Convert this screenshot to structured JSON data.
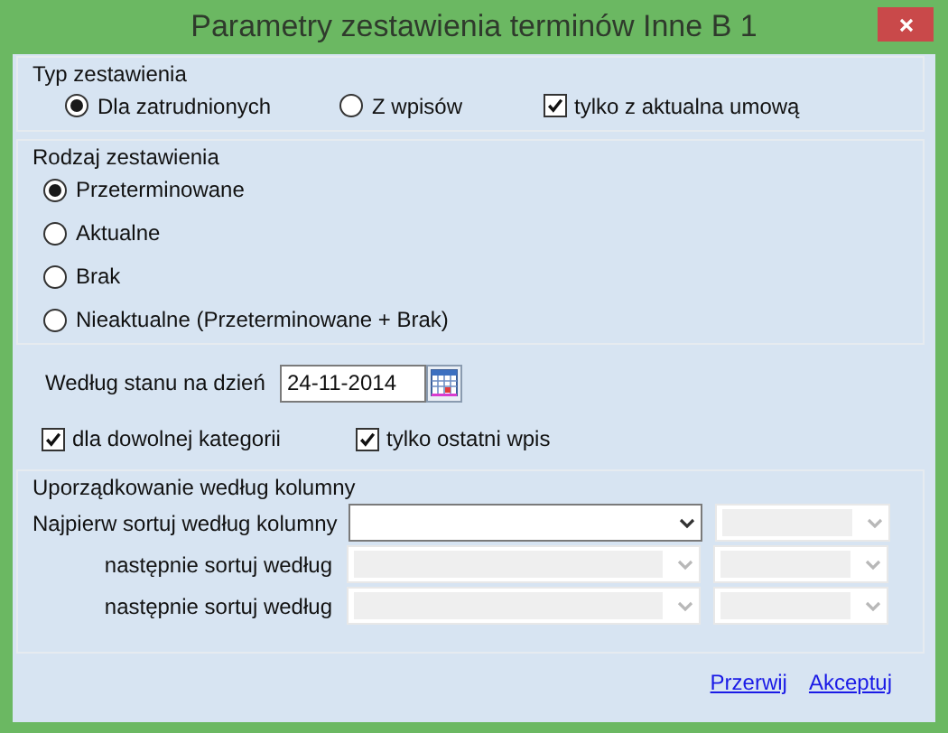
{
  "window": {
    "title": "Parametry zestawienia terminów Inne B 1"
  },
  "type_group": {
    "title": "Typ zestawienia",
    "options": [
      {
        "label": "Dla zatrudnionych",
        "selected": true
      },
      {
        "label": "Z wpisów",
        "selected": false
      }
    ],
    "current_contract": {
      "label": "tylko z aktualna umową",
      "checked": true
    }
  },
  "kind_group": {
    "title": "Rodzaj zestawienia",
    "options": [
      {
        "label": "Przeterminowane",
        "selected": true
      },
      {
        "label": "Aktualne",
        "selected": false
      },
      {
        "label": "Brak",
        "selected": false
      },
      {
        "label": "Nieaktualne (Przeterminowane + Brak)",
        "selected": false
      }
    ]
  },
  "date": {
    "label": "Według stanu na dzień",
    "value": "24-11-2014"
  },
  "checks": [
    {
      "label": "dla dowolnej kategorii",
      "checked": true
    },
    {
      "label": "tylko ostatni wpis",
      "checked": true
    }
  ],
  "sort_group": {
    "title": "Uporządkowanie według kolumny",
    "rows": [
      {
        "label": "Najpierw sortuj według kolumny",
        "column": {
          "disabled": false
        },
        "order": {
          "disabled": true
        }
      },
      {
        "label": "następnie sortuj według",
        "column": {
          "disabled": true
        },
        "order": {
          "disabled": true
        }
      },
      {
        "label": "następnie sortuj według",
        "column": {
          "disabled": true
        },
        "order": {
          "disabled": true
        }
      }
    ]
  },
  "links": [
    "Przerwij",
    "Akceptuj"
  ]
}
